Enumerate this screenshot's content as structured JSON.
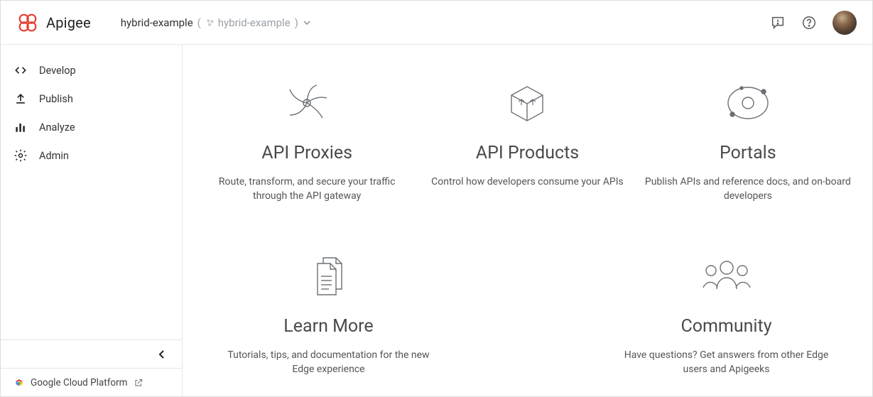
{
  "header": {
    "brand": "Apigee",
    "org_name": "hybrid-example",
    "org_chip": "hybrid-example"
  },
  "sidebar": {
    "items": [
      {
        "label": "Develop"
      },
      {
        "label": "Publish"
      },
      {
        "label": "Analyze"
      },
      {
        "label": "Admin"
      }
    ],
    "gcp_label": "Google Cloud Platform"
  },
  "main": {
    "cards": [
      {
        "title": "API Proxies",
        "desc": "Route, transform, and secure your traffic through the API gateway"
      },
      {
        "title": "API Products",
        "desc": "Control how developers consume your APIs"
      },
      {
        "title": "Portals",
        "desc": "Publish APIs and reference docs, and on-board developers"
      },
      {
        "title": "Learn More",
        "desc": "Tutorials, tips, and documentation for the new Edge experience"
      },
      {
        "title": "Community",
        "desc": "Have questions? Get answers from other Edge users and Apigeeks"
      }
    ]
  }
}
